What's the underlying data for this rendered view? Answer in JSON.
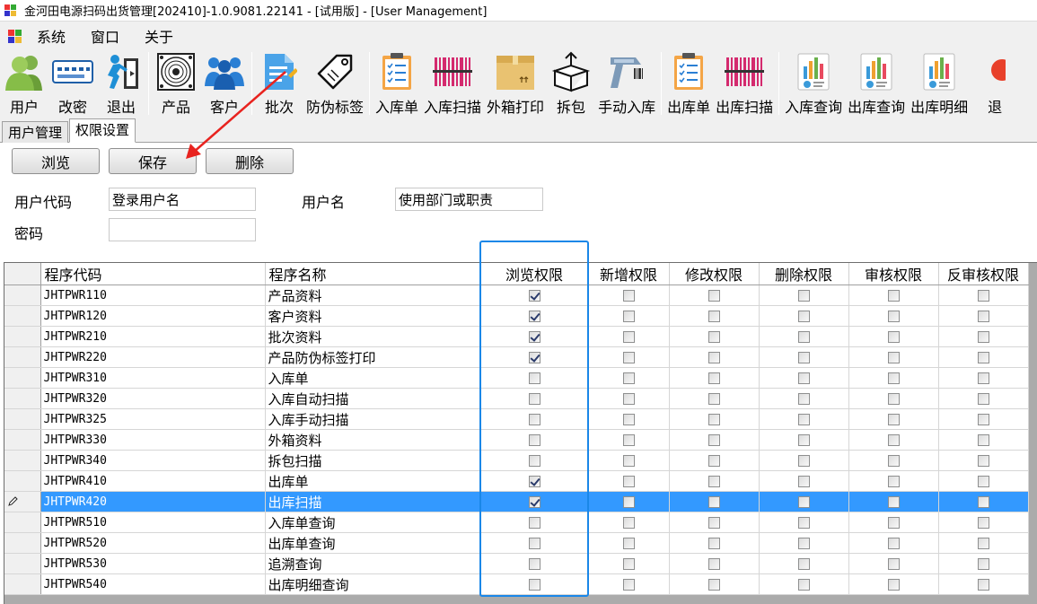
{
  "window": {
    "title": "金河田电源扫码出货管理[202410]-1.0.9081.22141 - [试用版] - [User Management]"
  },
  "menu": {
    "items": [
      "系统",
      "窗口",
      "关于"
    ]
  },
  "toolbar": {
    "items": [
      {
        "label": "用户",
        "icon": "users-icon"
      },
      {
        "label": "改密",
        "icon": "password-keypad-icon"
      },
      {
        "label": "退出",
        "icon": "exit-runner-icon"
      },
      {
        "label": "产品",
        "icon": "product-fan-icon"
      },
      {
        "label": "客户",
        "icon": "customers-icon"
      },
      {
        "label": "批次",
        "icon": "batch-document-icon"
      },
      {
        "label": "防伪标签",
        "icon": "tag-icon"
      },
      {
        "label": "入库单",
        "icon": "checklist-clipboard-icon"
      },
      {
        "label": "入库扫描",
        "icon": "barcode-icon"
      },
      {
        "label": "外箱打印",
        "icon": "carton-box-icon"
      },
      {
        "label": "拆包",
        "icon": "unpack-box-icon"
      },
      {
        "label": "手动入库",
        "icon": "barcode-scanner-icon"
      },
      {
        "label": "出库单",
        "icon": "checklist-clipboard-icon"
      },
      {
        "label": "出库扫描",
        "icon": "barcode-icon"
      },
      {
        "label": "入库查询",
        "icon": "report-chart-icon"
      },
      {
        "label": "出库查询",
        "icon": "report-chart-icon"
      },
      {
        "label": "出库明细",
        "icon": "report-chart-icon"
      },
      {
        "label": "退",
        "icon": "return-icon"
      }
    ]
  },
  "tabs": [
    "用户管理",
    "权限设置"
  ],
  "buttons": {
    "browse": "浏览",
    "save": "保存",
    "delete": "删除"
  },
  "form": {
    "user_code_label": "用户代码",
    "user_code_value": "登录用户名",
    "user_name_label": "用户名",
    "user_name_value": "使用部门或职责",
    "password_label": "密码",
    "password_value": ""
  },
  "grid": {
    "columns": [
      "程序代码",
      "程序名称",
      "浏览权限",
      "新增权限",
      "修改权限",
      "删除权限",
      "审核权限",
      "反审核权限"
    ],
    "selected_row": 10,
    "rows": [
      {
        "code": "JHTPWR110",
        "name": "产品资料",
        "perms": [
          true,
          false,
          false,
          false,
          false,
          false
        ]
      },
      {
        "code": "JHTPWR120",
        "name": "客户资料",
        "perms": [
          true,
          false,
          false,
          false,
          false,
          false
        ]
      },
      {
        "code": "JHTPWR210",
        "name": "批次资料",
        "perms": [
          true,
          false,
          false,
          false,
          false,
          false
        ]
      },
      {
        "code": "JHTPWR220",
        "name": "产品防伪标签打印",
        "perms": [
          true,
          false,
          false,
          false,
          false,
          false
        ]
      },
      {
        "code": "JHTPWR310",
        "name": "入库单",
        "perms": [
          false,
          false,
          false,
          false,
          false,
          false
        ]
      },
      {
        "code": "JHTPWR320",
        "name": "入库自动扫描",
        "perms": [
          false,
          false,
          false,
          false,
          false,
          false
        ]
      },
      {
        "code": "JHTPWR325",
        "name": "入库手动扫描",
        "perms": [
          false,
          false,
          false,
          false,
          false,
          false
        ]
      },
      {
        "code": "JHTPWR330",
        "name": "外箱资料",
        "perms": [
          false,
          false,
          false,
          false,
          false,
          false
        ]
      },
      {
        "code": "JHTPWR340",
        "name": "拆包扫描",
        "perms": [
          false,
          false,
          false,
          false,
          false,
          false
        ]
      },
      {
        "code": "JHTPWR410",
        "name": "出库单",
        "perms": [
          true,
          false,
          false,
          false,
          false,
          false
        ]
      },
      {
        "code": "JHTPWR420",
        "name": "出库扫描",
        "perms": [
          true,
          false,
          false,
          false,
          false,
          false
        ]
      },
      {
        "code": "JHTPWR510",
        "name": "入库单查询",
        "perms": [
          false,
          false,
          false,
          false,
          false,
          false
        ]
      },
      {
        "code": "JHTPWR520",
        "name": "出库单查询",
        "perms": [
          false,
          false,
          false,
          false,
          false,
          false
        ]
      },
      {
        "code": "JHTPWR530",
        "name": "追溯查询",
        "perms": [
          false,
          false,
          false,
          false,
          false,
          false
        ]
      },
      {
        "code": "JHTPWR540",
        "name": "出库明细查询",
        "perms": [
          false,
          false,
          false,
          false,
          false,
          false
        ]
      }
    ]
  },
  "colors": {
    "selection": "#3399ff",
    "highlight_box": "#1a87e8",
    "annotation_arrow": "#e8231f"
  }
}
